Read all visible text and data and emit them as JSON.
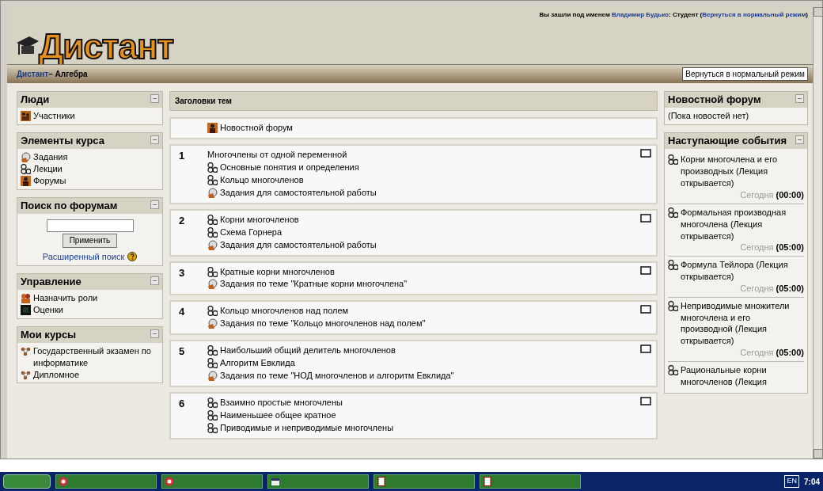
{
  "header": {
    "logo": "Дистант",
    "login": {
      "prefix": "Вы зашли под именем",
      "user": "Владимир Будько",
      "role": ": Студент (",
      "switch_link": "Вернуться в нормальный режим",
      "suffix": ")"
    }
  },
  "navbar": {
    "home": "Дистант",
    "separator": "–",
    "current": "Алгебра",
    "button": "Вернуться в нормальный режим"
  },
  "left_blocks": [
    {
      "kind": "links",
      "title": "Люди",
      "items": [
        {
          "kind": "people",
          "text": "Участники"
        }
      ]
    },
    {
      "kind": "links",
      "title": "Элементы курса",
      "items": [
        {
          "kind": "assignment",
          "text": "Задания"
        },
        {
          "kind": "lecture",
          "text": "Лекции"
        },
        {
          "kind": "forum",
          "text": "Форумы"
        }
      ]
    },
    {
      "kind": "search",
      "title": "Поиск по форумам",
      "button": "Применить",
      "link": "Расширенный поиск"
    },
    {
      "kind": "links",
      "title": "Управление",
      "items": [
        {
          "kind": "roles",
          "text": "Назначить роли"
        },
        {
          "kind": "grades",
          "text": "Оценки"
        }
      ]
    },
    {
      "kind": "links",
      "title": "Мои курсы",
      "items": [
        {
          "kind": "course",
          "text": "Государственный экзамен по информатике"
        },
        {
          "kind": "course",
          "text": "Дипломное"
        }
      ]
    }
  ],
  "topics": {
    "title": "Заголовки тем",
    "sections": [
      {
        "items": [
          {
            "kind": "forum",
            "text": "Новостной форум"
          }
        ]
      },
      {
        "number": "1",
        "summary": "Многочлены от одной переменной",
        "items": [
          {
            "kind": "lecture",
            "text": "Основные понятия и определения"
          },
          {
            "kind": "lecture",
            "text": "Кольцо многочленов"
          },
          {
            "kind": "assignment",
            "text": "Задания для самостоятельной работы"
          }
        ]
      },
      {
        "number": "2",
        "items": [
          {
            "kind": "lecture",
            "text": "Корни многочленов"
          },
          {
            "kind": "lecture",
            "text": "Схема Горнера"
          },
          {
            "kind": "assignment",
            "text": "Задания для самостоятельной работы"
          }
        ]
      },
      {
        "number": "3",
        "items": [
          {
            "kind": "lecture",
            "text": "Кратные корни многочленов"
          },
          {
            "kind": "assignment",
            "text": "Задания по теме \"Кратные корни многочлена\""
          }
        ]
      },
      {
        "number": "4",
        "items": [
          {
            "kind": "lecture",
            "text": "Кольцо многочленов над полем"
          },
          {
            "kind": "assignment",
            "text": "Задания по теме \"Кольцо многочленов над полем\""
          }
        ]
      },
      {
        "number": "5",
        "items": [
          {
            "kind": "lecture",
            "text": "Наибольший общий делитель многочленов"
          },
          {
            "kind": "lecture",
            "text": "Алгоритм Евклида"
          },
          {
            "kind": "assignment",
            "text": "Задания по теме \"НОД многочленов и алгоритм Евклида\""
          }
        ]
      },
      {
        "number": "6",
        "items": [
          {
            "kind": "lecture",
            "text": "Взаимно простые многочлены"
          },
          {
            "kind": "lecture",
            "text": "Наименьшее общее кратное"
          },
          {
            "kind": "lecture",
            "text": "Приводимые и неприводимые многочлены"
          }
        ]
      }
    ]
  },
  "news": {
    "title": "Новостной форум",
    "text": "(Пока новостей нет)"
  },
  "events": {
    "title": "Наступающие события",
    "items": [
      {
        "text": "Корни многочлена и его производных (Лекция открывается)",
        "day": "Сегодня",
        "time": "(00:00)"
      },
      {
        "text": "Формальная производная многочлена (Лекция открывается)",
        "day": "Сегодня",
        "time": "(05:00)"
      },
      {
        "text": "Формула Тейлора (Лекция открывается)",
        "day": "Сегодня",
        "time": "(05:00)"
      },
      {
        "text": "Неприводимые множители многочлена и его производной (Лекция открывается)",
        "day": "Сегодня",
        "time": "(05:00)"
      },
      {
        "text": "Рациональные корни многочленов (Лекция"
      }
    ]
  },
  "taskbar": {
    "windows": [
      {
        "kind": "browser"
      },
      {
        "kind": "browser"
      },
      {
        "kind": "folder"
      },
      {
        "kind": "document"
      },
      {
        "kind": "document"
      }
    ],
    "language": "EN",
    "clock": "7:04"
  }
}
